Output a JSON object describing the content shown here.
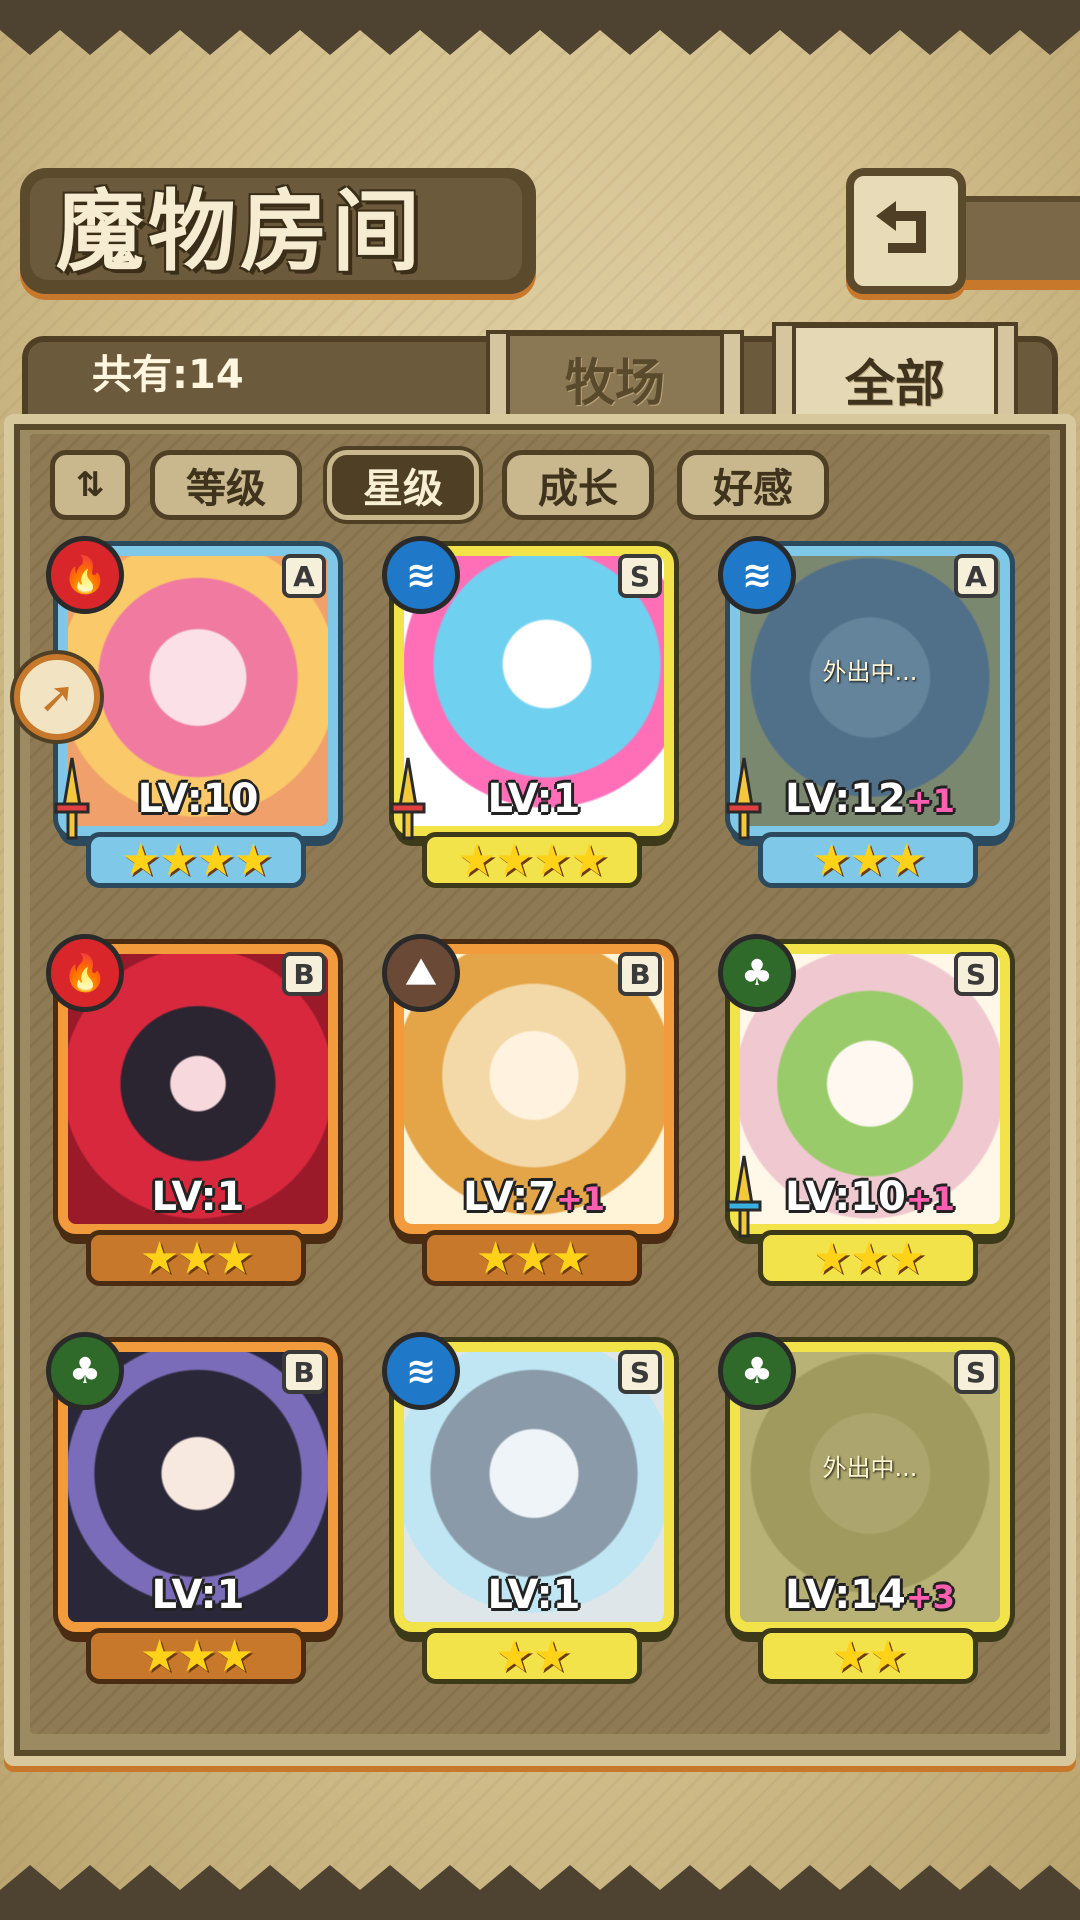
{
  "header": {
    "title": "魔物房间",
    "back_icon": "return-arrow-icon"
  },
  "tabs": {
    "ranch": "牧场",
    "all": "全部"
  },
  "count_label": "共有:14",
  "sort": {
    "toggle_glyph": "⇅",
    "buttons": [
      "等级",
      "星级",
      "成长",
      "好感"
    ],
    "active": "星级"
  },
  "monsters": [
    {
      "element": "fire",
      "element_glyph": "🔥",
      "rank": "A",
      "level": "LV:10",
      "plus": "",
      "stars": "★★★★",
      "away": ""
    },
    {
      "element": "water",
      "element_glyph": "≋",
      "rank": "S",
      "level": "LV:1",
      "plus": "",
      "stars": "★★★★",
      "away": ""
    },
    {
      "element": "water",
      "element_glyph": "≋",
      "rank": "A",
      "level": "LV:12",
      "plus": "+1",
      "stars": "★★★",
      "away": "外出中..."
    },
    {
      "element": "fire",
      "element_glyph": "🔥",
      "rank": "B",
      "level": "LV:1",
      "plus": "",
      "stars": "★★★",
      "away": ""
    },
    {
      "element": "earth",
      "element_glyph": "⛰",
      "rank": "B",
      "level": "LV:7",
      "plus": "+1",
      "stars": "★★★",
      "away": ""
    },
    {
      "element": "wood",
      "element_glyph": "♣",
      "rank": "S",
      "level": "LV:10",
      "plus": "+1",
      "stars": "★★★",
      "away": ""
    },
    {
      "element": "wood",
      "element_glyph": "♣",
      "rank": "B",
      "level": "LV:1",
      "plus": "",
      "stars": "★★★",
      "away": ""
    },
    {
      "element": "water",
      "element_glyph": "≋",
      "rank": "S",
      "level": "LV:1",
      "plus": "",
      "stars": "★★",
      "away": ""
    },
    {
      "element": "wood",
      "element_glyph": "♣",
      "rank": "S",
      "level": "LV:14",
      "plus": "+3",
      "stars": "★★",
      "away": "外出中..."
    }
  ],
  "side_arrow_glyph": "➚"
}
